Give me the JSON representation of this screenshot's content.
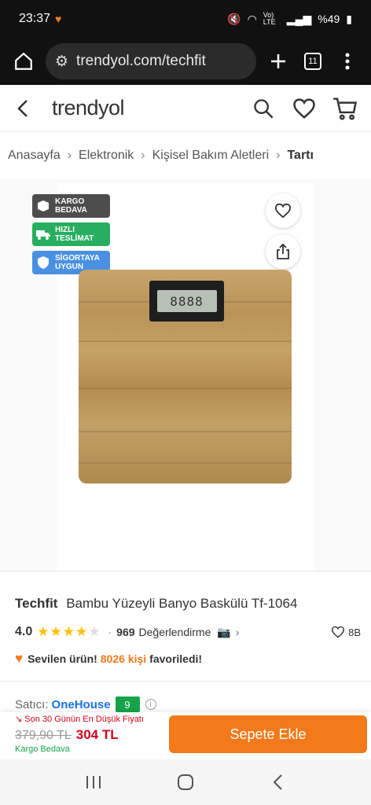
{
  "status_bar": {
    "time": "23:37",
    "battery": "%49",
    "signal_text": "Vo) LTE"
  },
  "browser": {
    "url": "trendyol.com/techfit",
    "tab_count": "11"
  },
  "header": {
    "logo": "trendyol"
  },
  "breadcrumb": {
    "items": [
      "Anasayfa",
      "Elektronik",
      "Kişisel Bakım Aletleri"
    ],
    "current": "Tartı"
  },
  "badges": [
    {
      "line1": "KARGO",
      "line2": "BEDAVA",
      "color": "#4d4d4d",
      "icon": "box-icon"
    },
    {
      "line1": "HIZLI",
      "line2": "TESLİMAT",
      "color": "#27ae60",
      "icon": "truck-icon"
    },
    {
      "line1": "SİGORTAYA",
      "line2": "UYGUN",
      "color": "#4a90e2",
      "icon": "shield-icon"
    }
  ],
  "product": {
    "brand": "Techfit",
    "name": "Bambu Yüzeyli Banyo Baskülü Tf-1064",
    "rating": "4.0",
    "stars_filled": 4,
    "review_count": "969",
    "review_label": "Değerlendirme",
    "favorites_count": "8B",
    "loved_prefix": "Sevilen ürün!",
    "loved_count": "8026 kişi",
    "loved_suffix": "favoriledi!",
    "scale_display": "8888"
  },
  "seller": {
    "label": "Satıcı:",
    "name": "OneHouse",
    "score": "9"
  },
  "purchase": {
    "lowest_text": "Son 30 Günün En Düşük Fiyatı",
    "old_price": "379,90 TL",
    "new_price": "304 TL",
    "shipping": "Kargo Bedava",
    "add_to_cart": "Sepete Ekle"
  },
  "colors": {
    "brand_orange": "#f27a1a",
    "price_red": "#d0021b",
    "seller_green": "#16a34a"
  }
}
